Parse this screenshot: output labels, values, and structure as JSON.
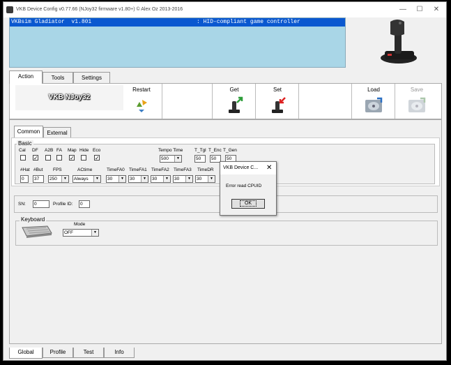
{
  "window": {
    "title": "VKB Device Config v0.77.66 (NJoy32 firmware v1.80+) © Alex Oz 2013-2016",
    "minimize": "—",
    "maximize": "☐",
    "close": "✕"
  },
  "device_list": {
    "selected_name": "VKBsim Gladiator  v1.801",
    "selected_type": ": HID-compliant game controller"
  },
  "main_tabs": [
    "Action",
    "Tools",
    "Settings"
  ],
  "toolbar": {
    "brand": "VKB NJoy32",
    "restart": "Restart",
    "get": "Get",
    "set": "Set",
    "load": "Load",
    "save": "Save"
  },
  "sub_tabs": [
    "Common",
    "External"
  ],
  "basic": {
    "group_label": "Basic",
    "flags": [
      {
        "label": "Cal",
        "checked": false
      },
      {
        "label": "DF",
        "checked": true
      },
      {
        "label": "A2B",
        "checked": false
      },
      {
        "label": "FA",
        "checked": false
      },
      {
        "label": "Map",
        "checked": true
      },
      {
        "label": "Hide",
        "checked": false
      },
      {
        "label": "Eco",
        "checked": true
      }
    ],
    "tempo_time_label": "Tempo Time",
    "tempo_time_value": "500",
    "t_tgl_label": "T_Tgl",
    "t_tgl_value": "50",
    "t_enc_label": "T_Enc",
    "t_enc_value": "50",
    "t_gen_label": "T_Gen",
    "t_gen_value": "50",
    "hat_label": "#Hat",
    "hat_value": "0",
    "but_label": "#But",
    "but_value": "37",
    "fps_label": "FPS",
    "fps_value": "250",
    "actime_label": "ACtime",
    "actime_value": "Always",
    "timefa": [
      {
        "label": "TimeFA0",
        "value": "30"
      },
      {
        "label": "TimeFA1",
        "value": "30"
      },
      {
        "label": "TimeFA2",
        "value": "30"
      },
      {
        "label": "TimeFA3",
        "value": "30"
      },
      {
        "label": "TimeDR",
        "value": "30"
      }
    ]
  },
  "ids": {
    "sn_label": "SN:",
    "sn_value": "0",
    "profile_label": "Profile ID:",
    "profile_value": "0"
  },
  "keyboard": {
    "group_label": "Keyboard",
    "mode_label": "Mode",
    "mode_value": "OFF"
  },
  "dialog": {
    "title": "VKB Device C...",
    "close": "✕",
    "message": "Error read CPUID",
    "ok": "OK"
  },
  "bottom_tabs": [
    "Global",
    "Profile",
    "Test",
    "Info"
  ]
}
